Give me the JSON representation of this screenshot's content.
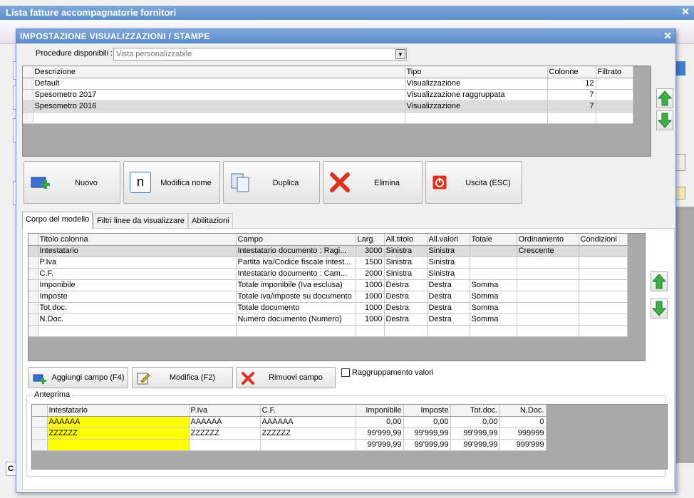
{
  "outer_window": {
    "title": "Lista fatture accompagnatorie fornitori"
  },
  "dialog": {
    "title": "IMPOSTAZIONE VISUALIZZAZIONI / STAMPE",
    "procedure_label": "Procedure disponibili :",
    "procedure_value": "Vista personalizzabile"
  },
  "views_table": {
    "headers": [
      "Descrizione",
      "Tipo",
      "Colonne",
      "Filtrato"
    ],
    "rows": [
      {
        "descrizione": "Default",
        "tipo": "Visualizzazione",
        "colonne": "12",
        "filtrato": ""
      },
      {
        "descrizione": "Spesometro 2017",
        "tipo": "Visualizzazione raggruppata",
        "colonne": "7",
        "filtrato": ""
      },
      {
        "descrizione": "Spesometro 2016",
        "tipo": "Visualizzazione",
        "colonne": "7",
        "filtrato": ""
      }
    ]
  },
  "buttons": {
    "nuovo": "Nuovo",
    "modifica_nome": "Modifica nome",
    "duplica": "Duplica",
    "elimina": "Elimina",
    "uscita": "Uscita (ESC)",
    "modifica_icon_letter": "n"
  },
  "tabs": [
    "Corpo del modello",
    "Filtri linee da visualizzare",
    "Abilitazioni"
  ],
  "columns_table": {
    "headers": [
      "Titolo colonna",
      "Campo",
      "Larg.",
      "All.titolo",
      "All.valori",
      "Totale",
      "Ordinamento",
      "Condizioni"
    ],
    "rows": [
      [
        "Intestatario",
        "Intestatario documento : Ragi...",
        "3000",
        "Sinistra",
        "Sinistra",
        "",
        "Crescente",
        ""
      ],
      [
        "P.Iva",
        "Partita iva/Codice fiscale intest...",
        "1500",
        "Sinistra",
        "Sinistra",
        "",
        "",
        ""
      ],
      [
        "C.F.",
        "Intestatario documento : Cam...",
        "2000",
        "Sinistra",
        "Sinistra",
        "",
        "",
        ""
      ],
      [
        "Imponibile",
        "Totale imponibile (Iva esclusa)",
        "1000",
        "Destra",
        "Destra",
        "Somma",
        "",
        ""
      ],
      [
        "Imposte",
        "Totale iva/imposte su documento",
        "1000",
        "Destra",
        "Destra",
        "Somma",
        "",
        ""
      ],
      [
        "Tot.doc.",
        "Totale documento",
        "1000",
        "Destra",
        "Destra",
        "Somma",
        "",
        ""
      ],
      [
        "N.Doc.",
        "Numero documento (Numero)",
        "1000",
        "Destra",
        "Destra",
        "Somma",
        "",
        ""
      ]
    ]
  },
  "field_buttons": {
    "aggiungi": "Aggiungi campo (F4)",
    "modifica": "Modifica (F2)",
    "rimuovi": "Rimuovi campo",
    "raggruppamento": "Raggruppamento valori"
  },
  "preview": {
    "legend": "Anteprima",
    "headers": [
      "Intestatario",
      "P.Iva",
      "C.F.",
      "Imponibile",
      "Imposte",
      "Tot.doc.",
      "N.Doc."
    ],
    "rows": [
      [
        "AAAAAA",
        "AAAAAA",
        "AAAAAA",
        "0,00",
        "0,00",
        "0,00",
        "0"
      ],
      [
        "ZZZZZZ",
        "ZZZZZZ",
        "ZZZZZZ",
        "99'999,99",
        "99'999,99",
        "99'999,99",
        "999999"
      ],
      [
        "",
        "",
        "",
        "99'999,99",
        "99'999,99",
        "99'999,99",
        "999'999"
      ]
    ]
  },
  "colors": {
    "title_bar": "#5e8fcc",
    "highlight": "#ffff00",
    "grid_bg": "#a9a9a9"
  }
}
